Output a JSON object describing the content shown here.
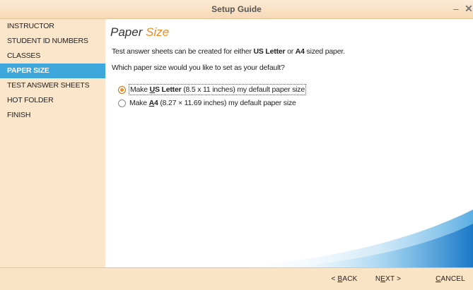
{
  "window": {
    "title": "Setup Guide",
    "minimize_glyph": "–",
    "close_glyph": "✕"
  },
  "sidebar": {
    "items": [
      {
        "label": "INSTRUCTOR"
      },
      {
        "label": "STUDENT ID NUMBERS"
      },
      {
        "label": "CLASSES"
      },
      {
        "label": "PAPER SIZE"
      },
      {
        "label": "TEST ANSWER SHEETS"
      },
      {
        "label": "HOT FOLDER"
      },
      {
        "label": "FINISH"
      }
    ],
    "active_index": 3
  },
  "main": {
    "heading_part1": "Paper",
    "heading_part2": "Size",
    "desc_prefix": "Test answer sheets can be created for either",
    "desc_kw1": "US Letter",
    "desc_mid": "or",
    "desc_kw2": "A4",
    "desc_suffix": "sized paper.",
    "question": "Which paper size would you like to set as your default?",
    "options": [
      {
        "pre": "Make",
        "kw_underlined": "U",
        "kw_rest": "S Letter",
        "post": "(8.5 x 11 inches) my default paper size",
        "checked": true
      },
      {
        "pre": "Make",
        "kw_underlined": "A",
        "kw_rest": "4",
        "post": "(8.27 × 11.69 inches) my default paper size",
        "checked": false
      }
    ]
  },
  "footer": {
    "back": {
      "pre": "< ",
      "key": "B",
      "rest": "ACK"
    },
    "next": {
      "pre": "N",
      "key": "E",
      "rest": "XT >"
    },
    "cancel": {
      "pre": "",
      "key": "C",
      "rest": "ANCEL"
    }
  },
  "colors": {
    "accent": "#3ea7dc",
    "heading_accent": "#f08a1c",
    "chrome": "#fbe3c6"
  }
}
